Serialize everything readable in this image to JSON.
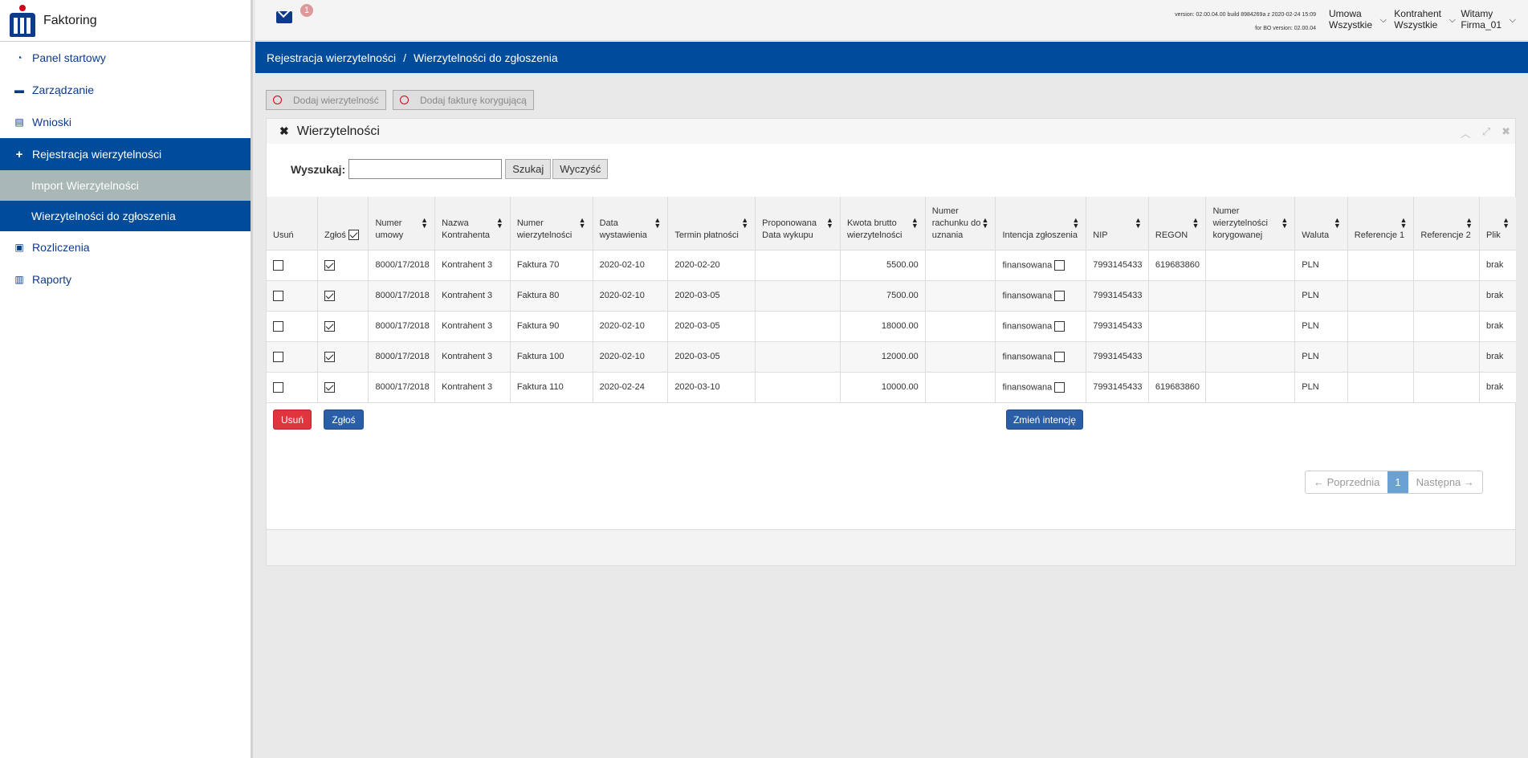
{
  "app": {
    "title": "Faktoring"
  },
  "sidebar": {
    "items": [
      {
        "label": "Panel startowy",
        "icon": "dashboard-icon"
      },
      {
        "label": "Zarządzanie",
        "icon": "briefcase-icon"
      },
      {
        "label": "Wnioski",
        "icon": "document-icon"
      },
      {
        "label": "Rejestracja wierzytelności",
        "icon": "plus-icon"
      },
      {
        "label": "Rozliczenia",
        "icon": "money-icon"
      },
      {
        "label": "Raporty",
        "icon": "bar-chart-icon"
      }
    ],
    "sub_items": [
      {
        "label": "Import Wierzytelności"
      },
      {
        "label": "Wierzytelności do zgłoszenia"
      }
    ]
  },
  "header": {
    "mail_count": "1",
    "version_line1": "version: 02.00.04.00 build 8984269a z 2020-02-24 15:09",
    "version_line2": "for BO version: 02.00.04",
    "umowa_label": "Umowa",
    "umowa_value": "Wszystkie",
    "kontrahent_label": "Kontrahent",
    "kontrahent_value": "Wszystkie",
    "user_greeting": "Witamy",
    "user_name": "Firma_01"
  },
  "breadcrumb": {
    "parent": "Rejestracja wierzytelności",
    "separator": "/",
    "current": "Wierzytelności do zgłoszenia"
  },
  "actions": {
    "add_claim": "Dodaj wierzytelność",
    "add_correction": "Dodaj fakturę korygującą"
  },
  "panel": {
    "title": "Wierzytelności",
    "search_label": "Wyszukaj:",
    "search_value": "",
    "search_button": "Szukaj",
    "clear_button": "Wyczyść",
    "columns": [
      "Usuń",
      "Zgłoś",
      "Numer umowy",
      "Nazwa Kontrahenta",
      "Numer wierzytelności",
      "Data wystawienia",
      "Termin płatności",
      "Proponowana Data wykupu",
      "Kwota brutto wierzytelności",
      "Numer rachunku do uznania",
      "Intencja zgłoszenia",
      "NIP",
      "REGON",
      "Numer wierzytelności korygowanej",
      "Waluta",
      "Referencje 1",
      "Referencje 2",
      "Plik"
    ],
    "rows": [
      {
        "zglos": true,
        "umowa": "8000/17/2018",
        "kontrahent": "Kontrahent 3",
        "numer": "Faktura 70",
        "data": "2020-02-10",
        "termin": "2020-02-20",
        "wykup": "",
        "kwota": "5500.00",
        "rachunek": "",
        "intencja": "finansowana",
        "nip": "7993145433",
        "regon": "619683860",
        "korygowana": "",
        "waluta": "PLN",
        "ref1": "",
        "ref2": "",
        "plik": "brak"
      },
      {
        "zglos": true,
        "umowa": "8000/17/2018",
        "kontrahent": "Kontrahent 3",
        "numer": "Faktura 80",
        "data": "2020-02-10",
        "termin": "2020-03-05",
        "wykup": "",
        "kwota": "7500.00",
        "rachunek": "",
        "intencja": "finansowana",
        "nip": "7993145433",
        "regon": "",
        "korygowana": "",
        "waluta": "PLN",
        "ref1": "",
        "ref2": "",
        "plik": "brak"
      },
      {
        "zglos": true,
        "umowa": "8000/17/2018",
        "kontrahent": "Kontrahent 3",
        "numer": "Faktura 90",
        "data": "2020-02-10",
        "termin": "2020-03-05",
        "wykup": "",
        "kwota": "18000.00",
        "rachunek": "",
        "intencja": "finansowana",
        "nip": "7993145433",
        "regon": "",
        "korygowana": "",
        "waluta": "PLN",
        "ref1": "",
        "ref2": "",
        "plik": "brak"
      },
      {
        "zglos": true,
        "umowa": "8000/17/2018",
        "kontrahent": "Kontrahent 3",
        "numer": "Faktura 100",
        "data": "2020-02-10",
        "termin": "2020-03-05",
        "wykup": "",
        "kwota": "12000.00",
        "rachunek": "",
        "intencja": "finansowana",
        "nip": "7993145433",
        "regon": "",
        "korygowana": "",
        "waluta": "PLN",
        "ref1": "",
        "ref2": "",
        "plik": "brak"
      },
      {
        "zglos": true,
        "umowa": "8000/17/2018",
        "kontrahent": "Kontrahent 3",
        "numer": "Faktura 110",
        "data": "2020-02-24",
        "termin": "2020-03-10",
        "wykup": "",
        "kwota": "10000.00",
        "rachunek": "",
        "intencja": "finansowana",
        "nip": "7993145433",
        "regon": "619683860",
        "korygowana": "",
        "waluta": "PLN",
        "ref1": "",
        "ref2": "",
        "plik": "brak"
      }
    ],
    "delete_button": "Usuń",
    "submit_button": "Zgłoś",
    "change_intent_button": "Zmień intencję",
    "pager": {
      "prev": "← Poprzednia",
      "current": "1",
      "next": "Następna →"
    }
  },
  "colors": {
    "primary": "#004c9b",
    "danger": "#e0353e",
    "button_blue": "#2a5fa8"
  }
}
